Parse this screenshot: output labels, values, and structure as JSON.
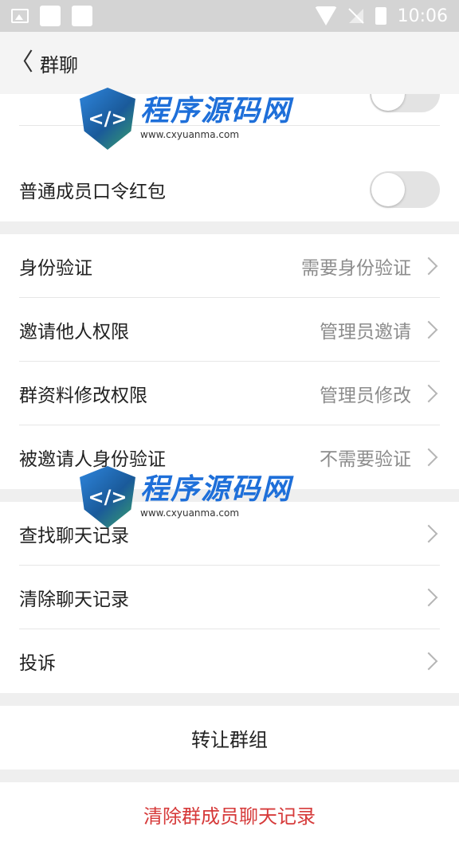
{
  "status_bar": {
    "time": "10:06"
  },
  "header": {
    "title": "群聊"
  },
  "toggles": [
    {
      "label": "普通成员口令红包",
      "on": false
    }
  ],
  "settings_group": [
    {
      "label": "身份验证",
      "value": "需要身份验证"
    },
    {
      "label": "邀请他人权限",
      "value": "管理员邀请"
    },
    {
      "label": "群资料修改权限",
      "value": "管理员修改"
    },
    {
      "label": "被邀请人身份验证",
      "value": "不需要验证"
    }
  ],
  "record_group": [
    {
      "label": "查找聊天记录"
    },
    {
      "label": "清除聊天记录"
    },
    {
      "label": "投诉"
    }
  ],
  "buttons": {
    "transfer": "转让群组",
    "clear_members": "清除群成员聊天记录"
  },
  "watermark": {
    "main": "程序源码网",
    "url": "www.cxyuanma.com"
  },
  "colors": {
    "danger": "#d63a3a",
    "accent": "#1e6fd9"
  }
}
